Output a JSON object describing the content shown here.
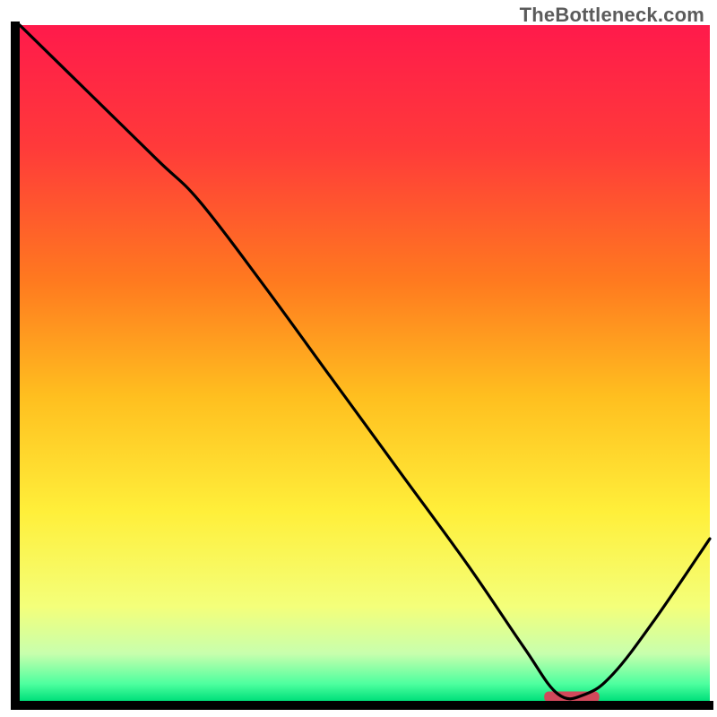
{
  "watermark": "TheBottleneck.com",
  "chart_data": {
    "type": "line",
    "title": "",
    "xlabel": "",
    "ylabel": "",
    "xlim": [
      0,
      100
    ],
    "ylim": [
      0,
      100
    ],
    "grid": false,
    "legend": false,
    "description": "Bottleneck deviation curve over a red-yellow-green vertical gradient; high values indicate mismatch (red zone), trough near x≈80 indicates optimal balance (green zone). A short red bar marks the recommended range at the trough.",
    "series": [
      {
        "name": "bottleneck-curve",
        "x": [
          0,
          10,
          20,
          26,
          35,
          45,
          55,
          65,
          73,
          78,
          82,
          86,
          92,
          100
        ],
        "values": [
          100,
          90,
          80,
          74,
          62,
          48,
          34,
          20,
          8,
          1,
          1,
          4,
          12,
          24
        ]
      }
    ],
    "optimal_marker": {
      "x_start": 76,
      "x_end": 84,
      "y": 0.6,
      "color": "#d1495b"
    },
    "gradient_stops": [
      {
        "offset": 0.0,
        "color": "#ff1a4b"
      },
      {
        "offset": 0.18,
        "color": "#ff3a3a"
      },
      {
        "offset": 0.38,
        "color": "#ff7a1f"
      },
      {
        "offset": 0.55,
        "color": "#ffbf1f"
      },
      {
        "offset": 0.72,
        "color": "#ffef3a"
      },
      {
        "offset": 0.86,
        "color": "#f4ff7a"
      },
      {
        "offset": 0.93,
        "color": "#c8ffad"
      },
      {
        "offset": 0.975,
        "color": "#4dff9f"
      },
      {
        "offset": 1.0,
        "color": "#00e07a"
      }
    ]
  }
}
